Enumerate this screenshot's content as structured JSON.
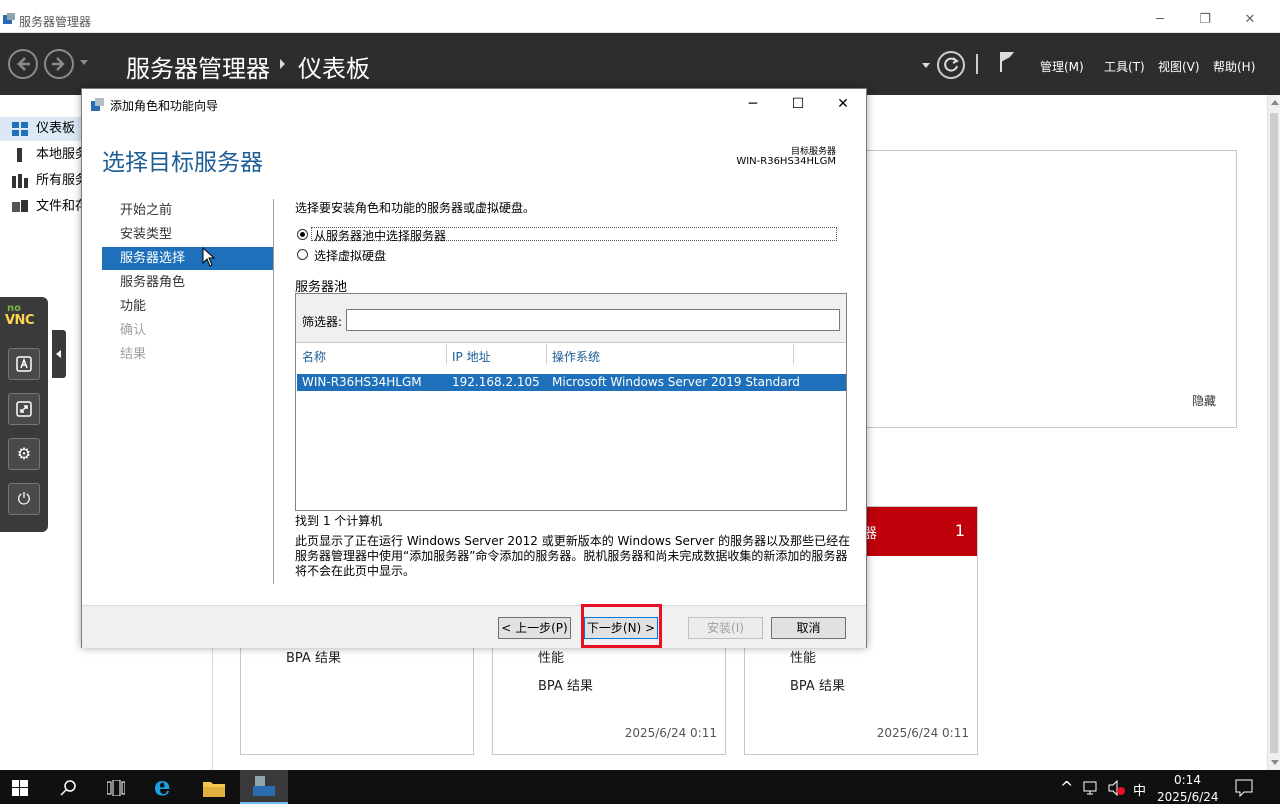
{
  "outer_window": {
    "title": "服务器管理器",
    "controls": [
      "minimize-icon",
      "restore-icon",
      "close-icon"
    ]
  },
  "header": {
    "breadcrumb_root": "服务器管理器",
    "breadcrumb_current": "仪表板",
    "menus": [
      {
        "label": "管理(M)"
      },
      {
        "label": "工具(T)"
      },
      {
        "label": "视图(V)"
      },
      {
        "label": "帮助(H)"
      }
    ]
  },
  "sidebar": {
    "items": [
      {
        "label": "仪表板",
        "icon": "dashboard-icon",
        "active": true
      },
      {
        "label": "本地服务器",
        "icon": "local-server-icon"
      },
      {
        "label": "所有服务器",
        "icon": "all-servers-icon"
      },
      {
        "label": "文件和存储服务",
        "icon": "file-storage-icon"
      }
    ]
  },
  "dashboard": {
    "hide_link": "隐藏",
    "tiles": [
      {
        "lines": [
          "BPA 结果"
        ],
        "date": ""
      },
      {
        "lines": [
          "性能",
          "BPA 结果"
        ],
        "date": "2025/6/24 0:11"
      },
      {
        "lines": [
          "性能",
          "BPA 结果"
        ],
        "date": "2025/6/24 0:11",
        "header_fragment": "器",
        "count": "1"
      }
    ]
  },
  "vnc": {
    "logo_top": "no",
    "logo": "VNC",
    "buttons": [
      "keyboard-icon",
      "scale-icon",
      "settings-icon",
      "power-icon"
    ]
  },
  "wizard": {
    "title": "添加角色和功能向导",
    "heading": "选择目标服务器",
    "target_label": "目标服务器",
    "target_value": "WIN-R36HS34HLGM",
    "steps": [
      {
        "label": "开始之前",
        "state": "normal"
      },
      {
        "label": "安装类型",
        "state": "normal"
      },
      {
        "label": "服务器选择",
        "state": "active"
      },
      {
        "label": "服务器角色",
        "state": "normal"
      },
      {
        "label": "功能",
        "state": "normal"
      },
      {
        "label": "确认",
        "state": "disabled"
      },
      {
        "label": "结果",
        "state": "disabled"
      }
    ],
    "instruction": "选择要安装角色和功能的服务器或虚拟硬盘。",
    "radio_pool": "从服务器池中选择服务器",
    "radio_vhd": "选择虚拟硬盘",
    "pool_title": "服务器池",
    "filter_label": "筛选器:",
    "filter_value": "",
    "columns": [
      "名称",
      "IP 地址",
      "操作系统"
    ],
    "rows": [
      {
        "name": "WIN-R36HS34HLGM",
        "ip": "192.168.2.105",
        "os": "Microsoft Windows Server 2019 Standard"
      }
    ],
    "found_count": "找到 1 个计算机",
    "description_1": "此页显示了正在运行 Windows Server 2012 或更新版本的 Windows Server 的服务器以及那些已经在",
    "description_2": "服务器管理器中使用“添加服务器”命令添加的服务器。脱机服务器和尚未完成数据收集的新添加的服务器",
    "description_3": "将不会在此页中显示。",
    "buttons": {
      "back": "< 上一步(P)",
      "next": "下一步(N) >",
      "install": "安装(I)",
      "cancel": "取消"
    }
  },
  "taskbar": {
    "apps": [
      "windows-start-icon",
      "search-icon",
      "task-view-icon",
      "ie-icon",
      "file-explorer-icon",
      "server-manager-icon"
    ],
    "ime": "中",
    "time": "0:14",
    "date": "2025/6/24"
  },
  "colors": {
    "accent_blue": "#1e70bb",
    "heading_blue": "#1c5e96",
    "header_dark": "#2d2d30",
    "alert_red": "#c0000b",
    "annotation_red": "#e81123"
  }
}
